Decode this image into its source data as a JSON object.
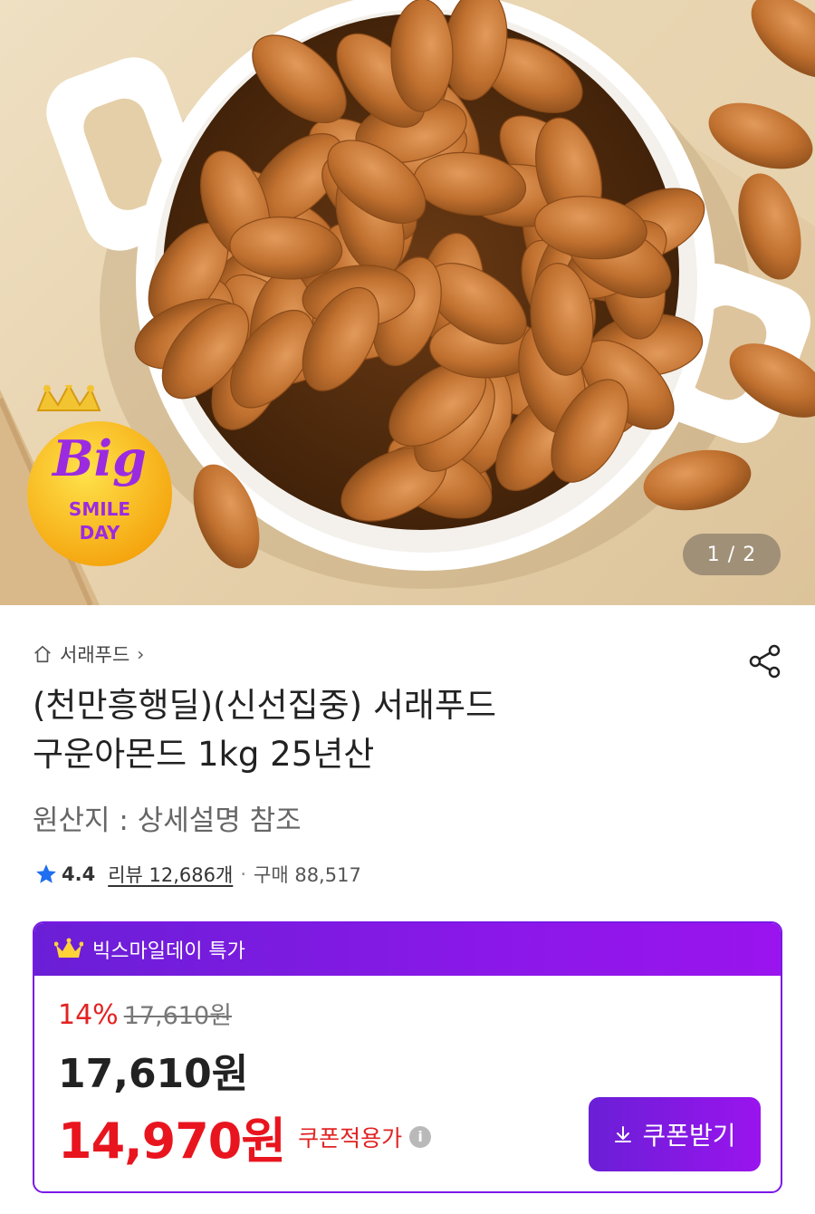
{
  "gallery": {
    "counter": "1 / 2"
  },
  "badge": {
    "line1": "Big",
    "line2": "SMILE",
    "line3": "DAY"
  },
  "breadcrumb": {
    "seller": "서래푸드"
  },
  "product": {
    "title_line1": "(천만흥행딜)(신선집중) 서래푸드",
    "title_line2": "구운아몬드 1kg 25년산",
    "origin": "원산지 : 상세설명 참조"
  },
  "rating": {
    "score": "4.4",
    "review_label": "리뷰 12,686개",
    "purchase_label": "구매 88,517"
  },
  "price_card": {
    "header": "빅스마일데이 특가",
    "discount_rate": "14%",
    "original_price": "17,610원",
    "sale_price": "17,610원",
    "coupon_price": "14,970원",
    "coupon_price_label": "쿠폰적용가",
    "coupon_button": "쿠폰받기"
  },
  "colors": {
    "accent": "#7a18e6",
    "price_red": "#e8151f",
    "star": "#1f6ff0"
  }
}
